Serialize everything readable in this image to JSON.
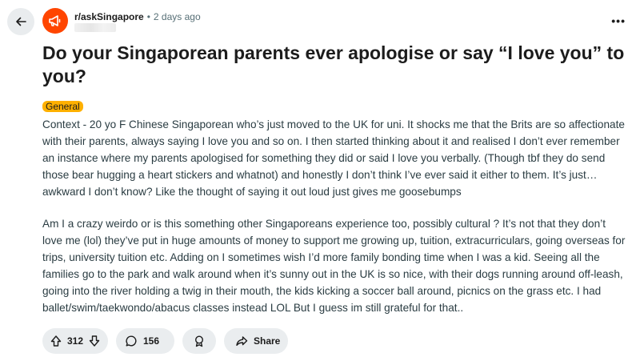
{
  "header": {
    "back_icon": "arrow-left-icon",
    "subreddit": "r/askSingapore",
    "separator": "•",
    "time_ago": "2 days ago",
    "more_label": "•••",
    "avatar_color": "#ff4500"
  },
  "post": {
    "title": "Do your Singaporean parents ever apologise or say “I love you” to you?",
    "flair": "General",
    "flair_color": "#ffb000",
    "paragraphs": [
      "Context - 20 yo F Chinese Singaporean who’s just moved to the UK for uni. It shocks me that the Brits are so affectionate with their parents, always saying I love you and so on. I then started thinking about it and realised I don’t ever remember an instance where my parents apologised for something they did or said I love you verbally. (Though tbf they do send those bear hugging a heart stickers and whatnot) and honestly I don’t think I’ve ever said it either to them. It’s just… awkward I don’t know? Like the thought of saying it out loud just gives me goosebumps",
      "Am I a crazy weirdo or is this something other Singaporeans experience too, possibly cultural ? It’s not that they don’t love me (lol) they’ve put in huge amounts of money to support me growing up, tuition, extracurriculars, going overseas for trips, university tuition etc. Adding on I sometimes wish I’d more family bonding time when I was a kid. Seeing all the families go to the park and walk around when it’s sunny out in the UK is so nice, with their dogs running around off-leash, going into the river holding a twig in their mouth, the kids kicking a soccer ball around, picnics on the grass etc. I had ballet/swim/taekwondo/abacus classes instead LOL But I guess im still grateful for that.."
    ]
  },
  "actions": {
    "upvote_icon": "upvote-arrow-icon",
    "votes": "312",
    "downvote_icon": "downvote-arrow-icon",
    "comment_icon": "comment-bubble-icon",
    "comments": "156",
    "award_icon": "award-icon",
    "share_icon": "share-arrow-icon",
    "share_label": "Share"
  }
}
